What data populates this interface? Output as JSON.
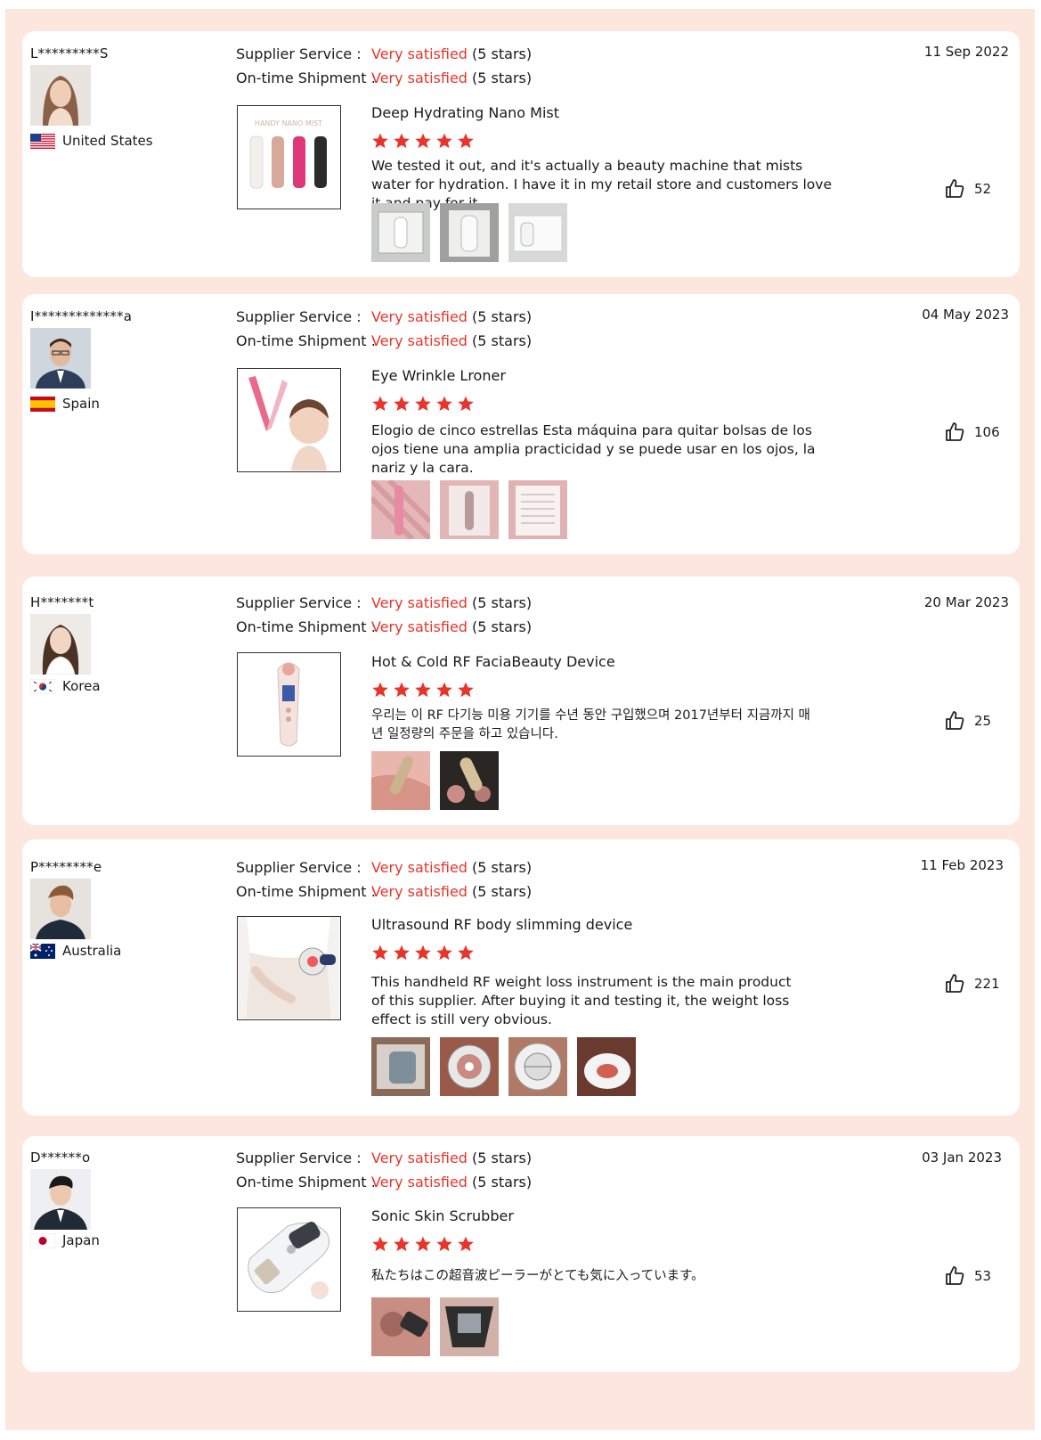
{
  "colors": {
    "accent": "#e8352b",
    "page_bg": "#fce6de"
  },
  "labels": {
    "supplier_service": "Supplier Service :",
    "ontime_shipment": "On-time Shipment :"
  },
  "reviews": [
    {
      "user": "L*********S",
      "country": "United States",
      "flag": "us-flag",
      "date": "11 Sep 2022",
      "supplier_value": "Very satisfied",
      "supplier_stars": "(5 stars)",
      "shipment_value": "Very satisfied",
      "shipment_stars": "(5 stars)",
      "product": "Deep Hydrating Nano Mist",
      "rating": 5,
      "text": "We tested it out, and it's actually a beauty machine that mists water for hydration. I have it in my retail store and customers love it and pay for it.",
      "likes": "52",
      "photo_count": 3
    },
    {
      "user": "I*************a",
      "country": "Spain",
      "flag": "es-flag",
      "date": "04 May 2023",
      "supplier_value": "Very satisfied",
      "supplier_stars": "(5 stars)",
      "shipment_value": "Very satisfied",
      "shipment_stars": "(5 stars)",
      "product": "Eye Wrinkle Lroner",
      "rating": 5,
      "text": "Elogio de cinco estrellas Esta máquina para quitar bolsas de los ojos tiene una amplia practicidad y se puede usar en los ojos, la nariz y la cara.",
      "likes": "106",
      "photo_count": 3
    },
    {
      "user": "H*******t",
      "country": "Korea",
      "flag": "kr-flag",
      "date": "20 Mar 2023",
      "supplier_value": "Very satisfied",
      "supplier_stars": "(5 stars)",
      "shipment_value": "Very satisfied",
      "shipment_stars": "(5 stars)",
      "product": "Hot & Cold RF FaciaBeauty Device",
      "rating": 5,
      "text": "우리는 이 RF 다기능 미용 기기를 수년 동안 구입했으며 2017년부터 지금까지 매년 일정량의 주문을 하고 있습니다.",
      "likes": "25",
      "photo_count": 2
    },
    {
      "user": "P********e",
      "country": "Australia",
      "flag": "au-flag",
      "date": "11 Feb 2023",
      "supplier_value": "Very satisfied",
      "supplier_stars": "(5 stars)",
      "shipment_value": "Very satisfied",
      "shipment_stars": "(5 stars)",
      "product": "Ultrasound RF body slimming device",
      "rating": 5,
      "text": "This handheld RF weight loss instrument is the main product of this supplier. After buying it and testing it, the weight loss effect is still very obvious.",
      "likes": "221",
      "photo_count": 4
    },
    {
      "user": "D******o",
      "country": "Japan",
      "flag": "jp-flag",
      "date": "03 Jan 2023",
      "supplier_value": "Very satisfied",
      "supplier_stars": "(5 stars)",
      "shipment_value": "Very satisfied",
      "shipment_stars": "(5 stars)",
      "product": "Sonic Skin Scrubber",
      "rating": 5,
      "text": "私たちはこの超音波ピーラーがとても気に入っています。",
      "likes": "53",
      "photo_count": 2
    }
  ]
}
